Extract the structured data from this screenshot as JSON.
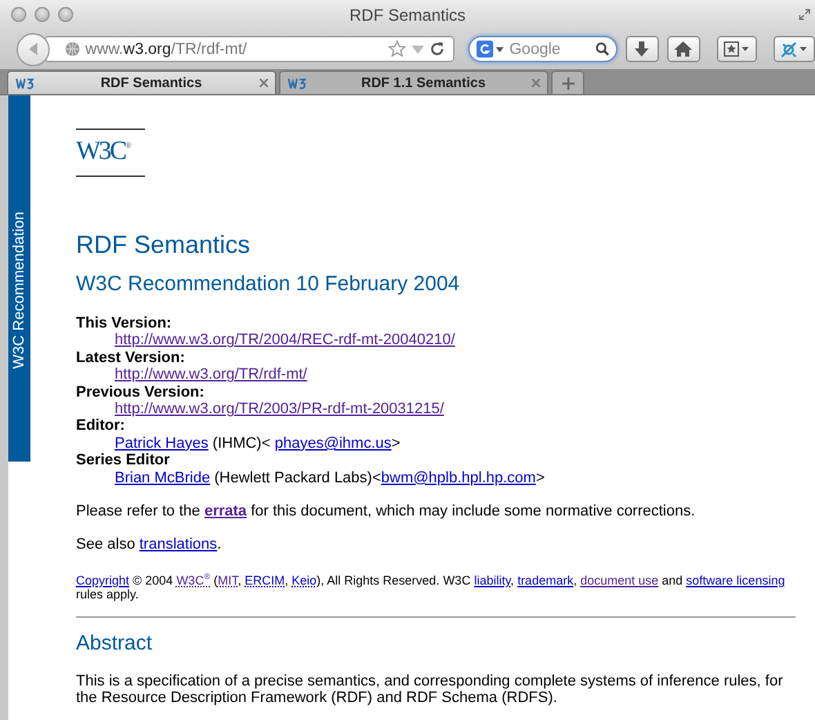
{
  "window": {
    "title": "RDF Semantics"
  },
  "toolbar": {
    "url": "www.**w3.org**/TR/rdf-mt/",
    "search": {
      "placeholder": "Google"
    }
  },
  "tabs": [
    {
      "label": "RDF Semantics",
      "selected": true
    },
    {
      "label": "RDF 1.1 Semantics",
      "selected": false
    }
  ],
  "page": {
    "side_label": "W3C Recommendation",
    "logo": "W3C",
    "logo_mark": "®",
    "title": "RDF Semantics",
    "subtitle": "W3C Recommendation 10 February 2004",
    "fields": [
      {
        "label": "This Version:",
        "lines": [
          [
            {
              "kind": "link",
              "text": "http://www.w3.org/TR/2004/REC-rdf-mt-20040210/",
              "visited": true
            }
          ]
        ]
      },
      {
        "label": "Latest Version:",
        "lines": [
          [
            {
              "kind": "link",
              "text": "http://www.w3.org/TR/rdf-mt/",
              "visited": true
            }
          ]
        ]
      },
      {
        "label": "Previous Version:",
        "lines": [
          [
            {
              "kind": "link",
              "text": "http://www.w3.org/TR/2003/PR-rdf-mt-20031215/",
              "visited": true
            }
          ]
        ]
      },
      {
        "label": "Editor:",
        "lines": [
          [
            {
              "kind": "link",
              "text": "Patrick Hayes",
              "visited": false
            },
            {
              "kind": "text",
              "text": " (IHMC)< "
            },
            {
              "kind": "link",
              "text": "phayes@ihmc.us",
              "visited": false
            },
            {
              "kind": "text",
              "text": ">"
            }
          ]
        ]
      },
      {
        "label": "Series Editor",
        "lines": [
          [
            {
              "kind": "link",
              "text": "Brian McBride",
              "visited": false
            },
            {
              "kind": "text",
              "text": " (Hewlett Packard Labs)<"
            },
            {
              "kind": "link",
              "text": "bwm@hplb.hpl.hp.com",
              "visited": false
            },
            {
              "kind": "text",
              "text": ">"
            }
          ]
        ]
      }
    ],
    "paragraphs": [
      [
        {
          "kind": "text",
          "text": "Please refer to the "
        },
        {
          "kind": "link",
          "text": "errata",
          "visited": true,
          "bold": true
        },
        {
          "kind": "text",
          "text": " for this document, which may include some normative corrections."
        }
      ],
      [
        {
          "kind": "text",
          "text": "See also "
        },
        {
          "kind": "link",
          "text": "translations",
          "visited": false
        },
        {
          "kind": "text",
          "text": "."
        }
      ]
    ],
    "copyright": [
      {
        "kind": "link",
        "text": "Copyright",
        "visited": false
      },
      {
        "kind": "text",
        "text": " © 2004 "
      },
      {
        "kind": "abbr",
        "text": "W3C$^{®}$",
        "visited": true
      },
      {
        "kind": "text",
        "text": " ("
      },
      {
        "kind": "abbr",
        "text": "MIT",
        "visited": true
      },
      {
        "kind": "text",
        "text": ", "
      },
      {
        "kind": "abbr",
        "text": "ERCIM",
        "visited": false
      },
      {
        "kind": "text",
        "text": ", "
      },
      {
        "kind": "abbr",
        "text": "Keio",
        "visited": false
      },
      {
        "kind": "text",
        "text": "), All Rights Reserved. W3C "
      },
      {
        "kind": "link",
        "text": "liability",
        "visited": false
      },
      {
        "kind": "text",
        "text": ", "
      },
      {
        "kind": "link",
        "text": "trademark",
        "visited": false
      },
      {
        "kind": "text",
        "text": ", "
      },
      {
        "kind": "link",
        "text": "document use",
        "visited": true
      },
      {
        "kind": "text",
        "text": " and "
      },
      {
        "kind": "link",
        "text": "software licensing",
        "visited": false
      },
      {
        "kind": "text",
        "text": " rules apply."
      }
    ],
    "abstract_heading": "Abstract",
    "abstract": "This is a specification of a precise semantics, and corresponding complete systems of inference rules, for the Resource Description Framework (RDF) and RDF Schema (RDFS)."
  }
}
